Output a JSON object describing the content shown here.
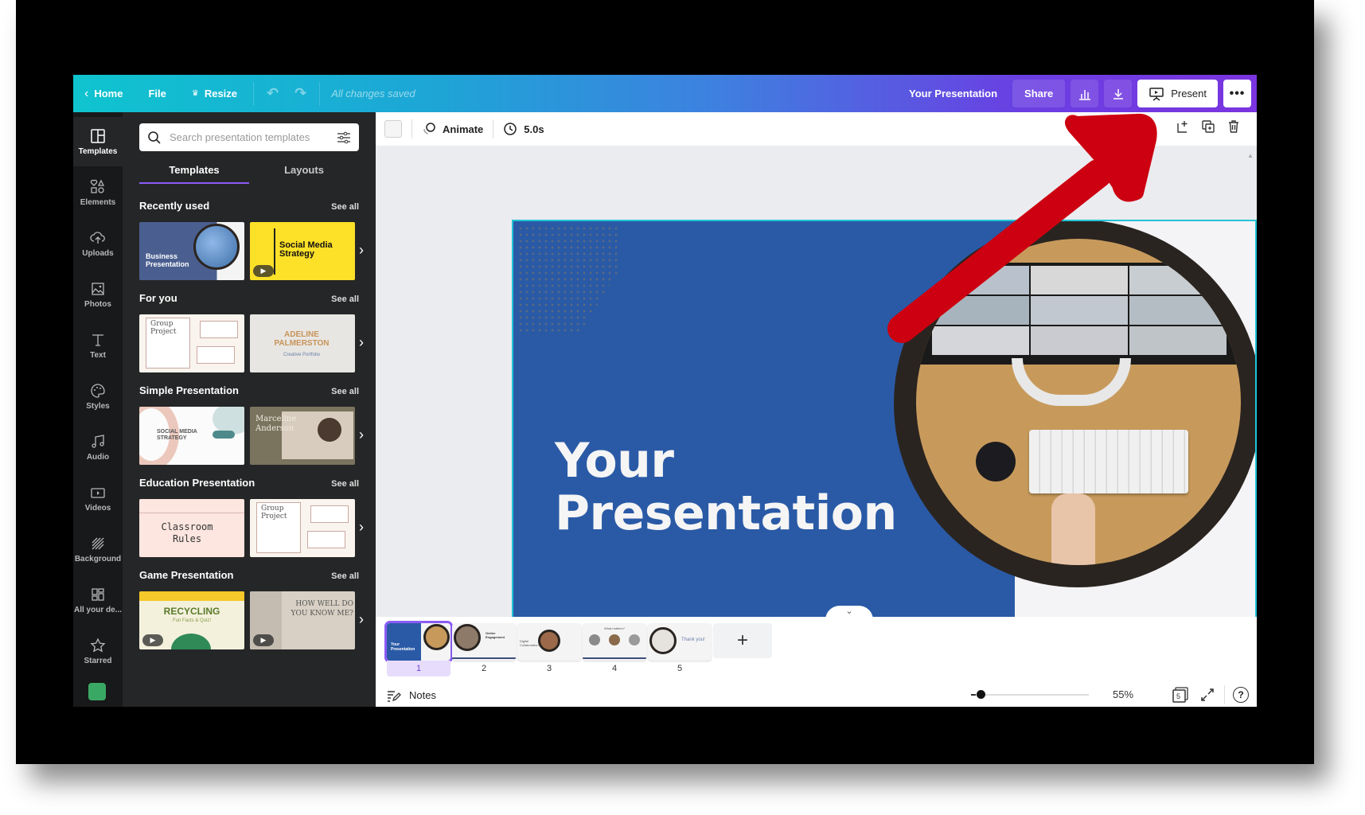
{
  "topbar": {
    "home_label": "Home",
    "file_label": "File",
    "resize_label": "Resize",
    "save_status": "All changes saved",
    "doc_title": "Your Presentation",
    "share_label": "Share",
    "present_label": "Present",
    "more_label": "•••"
  },
  "rail": {
    "items": [
      {
        "label": "Templates",
        "icon": "templates-icon"
      },
      {
        "label": "Elements",
        "icon": "elements-icon"
      },
      {
        "label": "Uploads",
        "icon": "upload-icon"
      },
      {
        "label": "Photos",
        "icon": "photos-icon"
      },
      {
        "label": "Text",
        "icon": "text-icon"
      },
      {
        "label": "Styles",
        "icon": "palette-icon"
      },
      {
        "label": "Audio",
        "icon": "music-icon"
      },
      {
        "label": "Videos",
        "icon": "video-icon"
      },
      {
        "label": "Background",
        "icon": "background-icon"
      },
      {
        "label": "All your de...",
        "icon": "grid-icon"
      },
      {
        "label": "Starred",
        "icon": "star-icon"
      }
    ]
  },
  "panel": {
    "search_placeholder": "Search presentation templates",
    "tabs": [
      "Templates",
      "Layouts"
    ],
    "see_all": "See all",
    "sections": [
      {
        "title": "Recently used",
        "thumbs": [
          {
            "title": "Business Presentation"
          },
          {
            "title": "Social Media Strategy",
            "video": true
          }
        ]
      },
      {
        "title": "For you",
        "thumbs": [
          {
            "title": "Group Project"
          },
          {
            "title": "ADELINE PALMERSTON",
            "subtitle": "Creative Portfolio"
          }
        ]
      },
      {
        "title": "Simple Presentation",
        "thumbs": [
          {
            "title": "SOCIAL MEDIA STRATEGY"
          },
          {
            "title": "Marceline Anderson"
          }
        ]
      },
      {
        "title": "Education Presentation",
        "thumbs": [
          {
            "title": "Classroom Rules"
          },
          {
            "title": "Group Project"
          }
        ]
      },
      {
        "title": "Game Presentation",
        "thumbs": [
          {
            "title": "RECYCLING",
            "subtitle": "Fun Facts & Quiz!",
            "video": true
          },
          {
            "title": "HOW WELL DO YOU KNOW ME?",
            "video": true
          }
        ]
      }
    ]
  },
  "toolbar": {
    "animate_label": "Animate",
    "duration": "5.0s"
  },
  "slide": {
    "title_line1": "Your",
    "title_line2": "Presentation",
    "colors": {
      "blue": "#2a5aa6",
      "ring": "#2a2420",
      "selection": "#21c4d6"
    }
  },
  "filmstrip": {
    "pages": [
      {
        "number": "1",
        "caption": "Your Presentation",
        "active": true
      },
      {
        "number": "2",
        "caption": "Online Engagement"
      },
      {
        "number": "3",
        "caption": "Digital Collaboration"
      },
      {
        "number": "4",
        "caption": "What matters?"
      },
      {
        "number": "5",
        "caption": "Thank you!"
      }
    ],
    "add_label": "+"
  },
  "status": {
    "notes_label": "Notes",
    "zoom_percent": "55%",
    "zoom_value": 0.05,
    "page_count": "5",
    "help_label": "?"
  },
  "annotation": {
    "type": "red-arrow",
    "points_to": "Present button",
    "color": "#cc0010"
  }
}
